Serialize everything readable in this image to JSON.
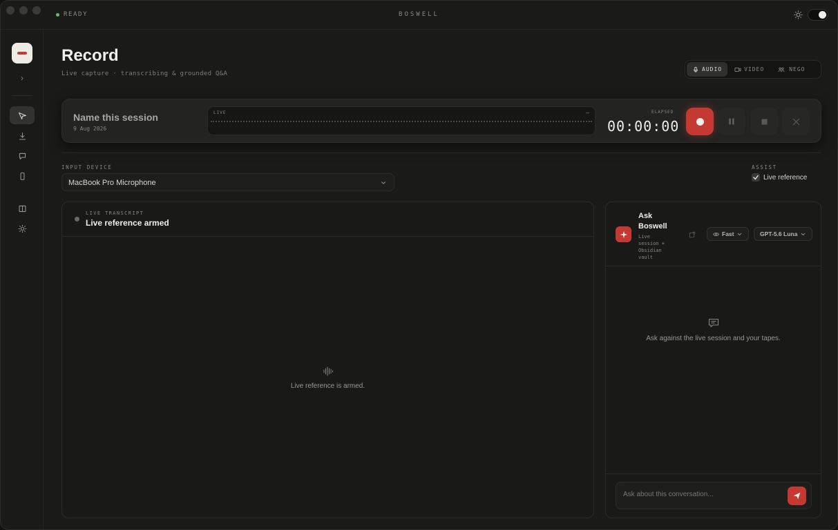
{
  "titlebar": {
    "status": "READY",
    "app_name": "BOSWELL"
  },
  "page": {
    "title": "Record",
    "subtitle": "Live capture · transcribing & grounded Q&A"
  },
  "modes": [
    {
      "label": "AUDIO",
      "icon": "mic-icon",
      "active": true
    },
    {
      "label": "VIDEO",
      "icon": "video-icon",
      "active": false
    },
    {
      "label": "NEGO",
      "icon": "people-icon",
      "active": false
    }
  ],
  "session": {
    "name_placeholder": "Name this session",
    "date": "9 Aug 2026",
    "waveform_label": "LIVE",
    "waveform_marker": "–",
    "elapsed_label": "ELAPSED",
    "elapsed": "00:00:00"
  },
  "input_device": {
    "label": "INPUT DEVICE",
    "value": "MacBook Pro Microphone"
  },
  "assist": {
    "label": "ASSIST",
    "option": "Live reference",
    "checked": true
  },
  "transcript": {
    "label": "LIVE TRANSCRIPT",
    "title": "Live reference armed",
    "empty_text": "Live reference is armed."
  },
  "ask": {
    "title": "Ask Boswell",
    "subtitle": "Live session + Obsidian vault",
    "speed": "Fast",
    "model": "GPT-5.6 Luna",
    "empty_text": "Ask against the live session and your tapes.",
    "input_placeholder": "Ask about this conversation..."
  },
  "colors": {
    "accent": "#c43a33",
    "ready": "#5fbf6a",
    "background": "#1a1a19"
  }
}
